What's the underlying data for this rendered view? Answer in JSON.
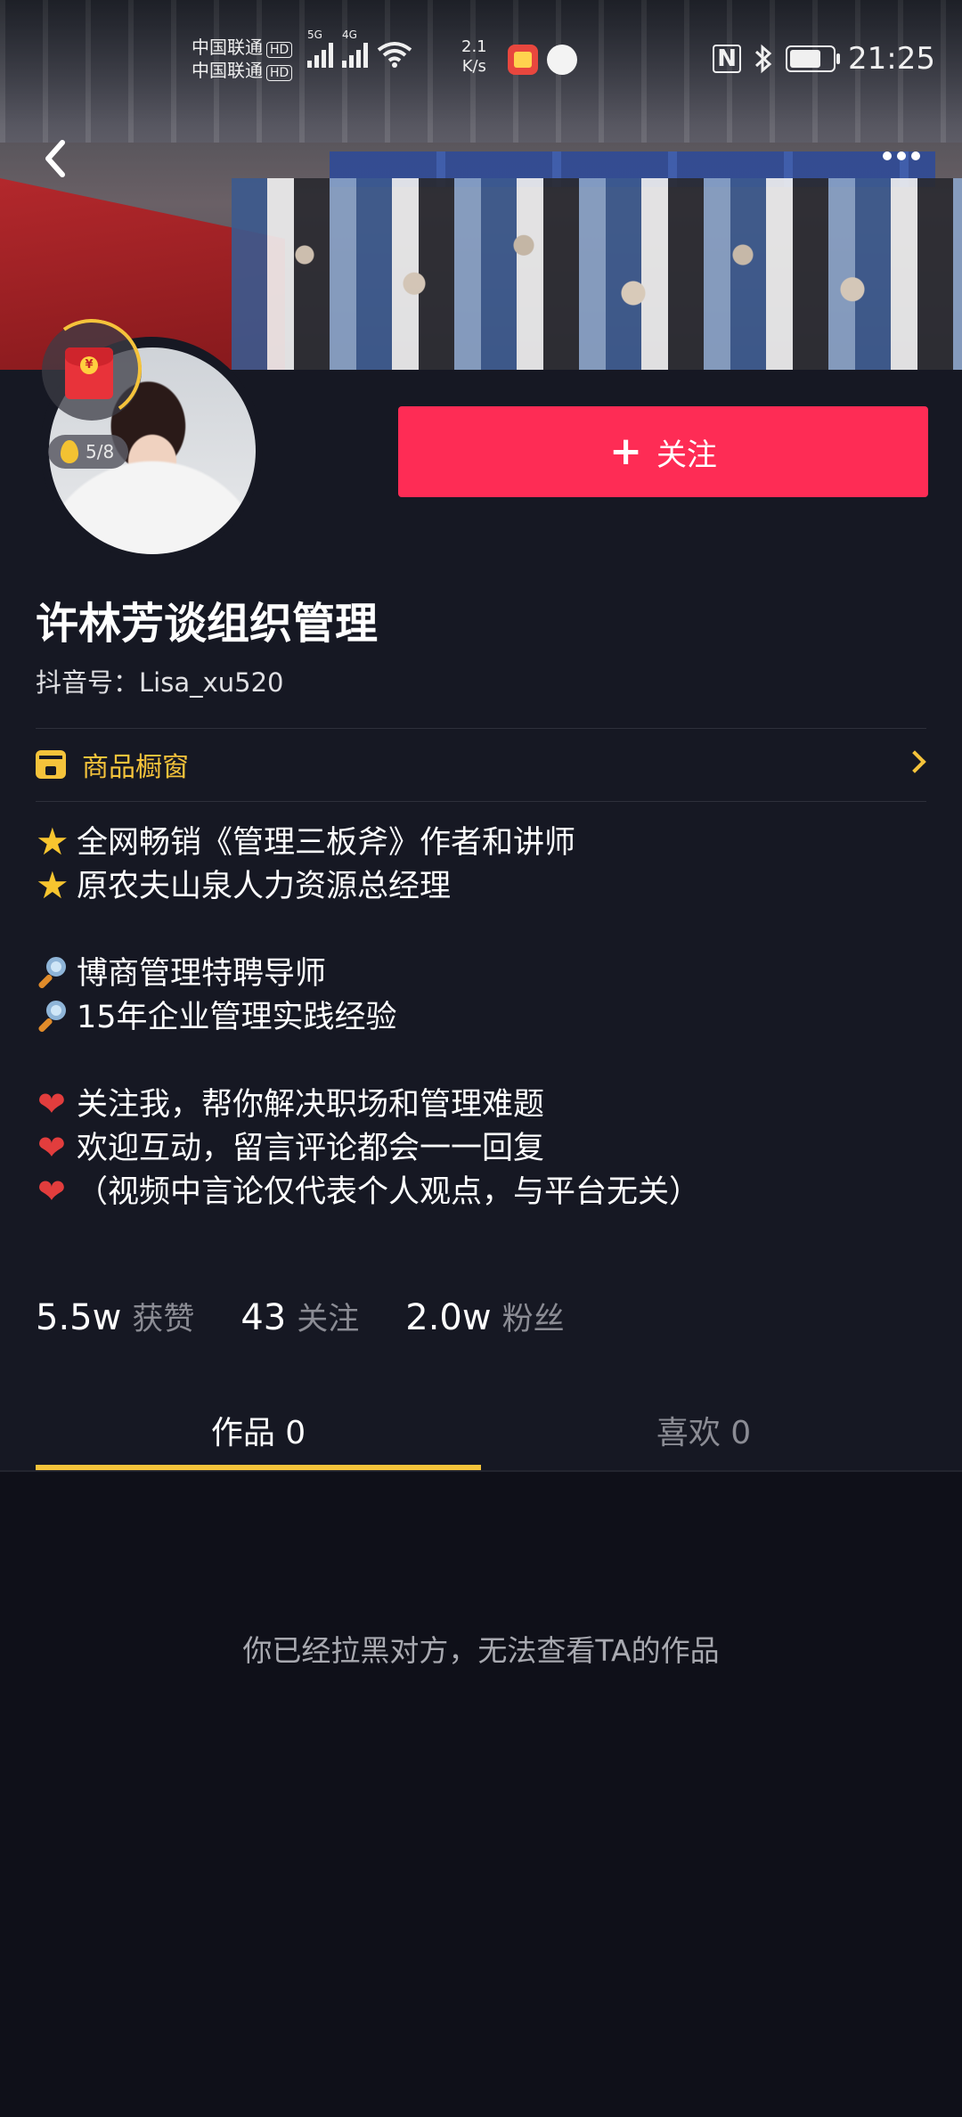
{
  "status_bar": {
    "carrier1": "中国联通",
    "carrier2": "中国联通",
    "hd_badge": "HD",
    "net1": "5G",
    "net2": "4G",
    "speed_value": "2.1",
    "speed_unit": "K/s",
    "nfc": "N",
    "time": "21:25"
  },
  "profile": {
    "redpacket_symbol": "¥",
    "egg_progress": "5/8",
    "follow_button": "关注",
    "name": "许林芳谈组织管理",
    "douyin_id": "抖音号：Lisa_xu520",
    "shop_window": "商品橱窗"
  },
  "bio": {
    "line1": "全网畅销《管理三板斧》作者和讲师",
    "line2": "原农夫山泉人力资源总经理",
    "line3": "博商管理特聘导师",
    "line4": "15年企业管理实践经验",
    "line5": "关注我，帮你解决职场和管理难题",
    "line6": "欢迎互动，留言评论都会一一回复",
    "line7": "（视频中言论仅代表个人观点，与平台无关）"
  },
  "stats": {
    "likes_num": "5.5w",
    "likes_label": "获赞",
    "following_num": "43",
    "following_label": "关注",
    "fans_num": "2.0w",
    "fans_label": "粉丝"
  },
  "tabs": {
    "works": "作品 0",
    "likes": "喜欢 0"
  },
  "empty_message": "你已经拉黑对方，无法查看TA的作品",
  "colors": {
    "background": "#161823",
    "accent_red": "#fe2c55",
    "accent_yellow": "#f5c33b"
  }
}
